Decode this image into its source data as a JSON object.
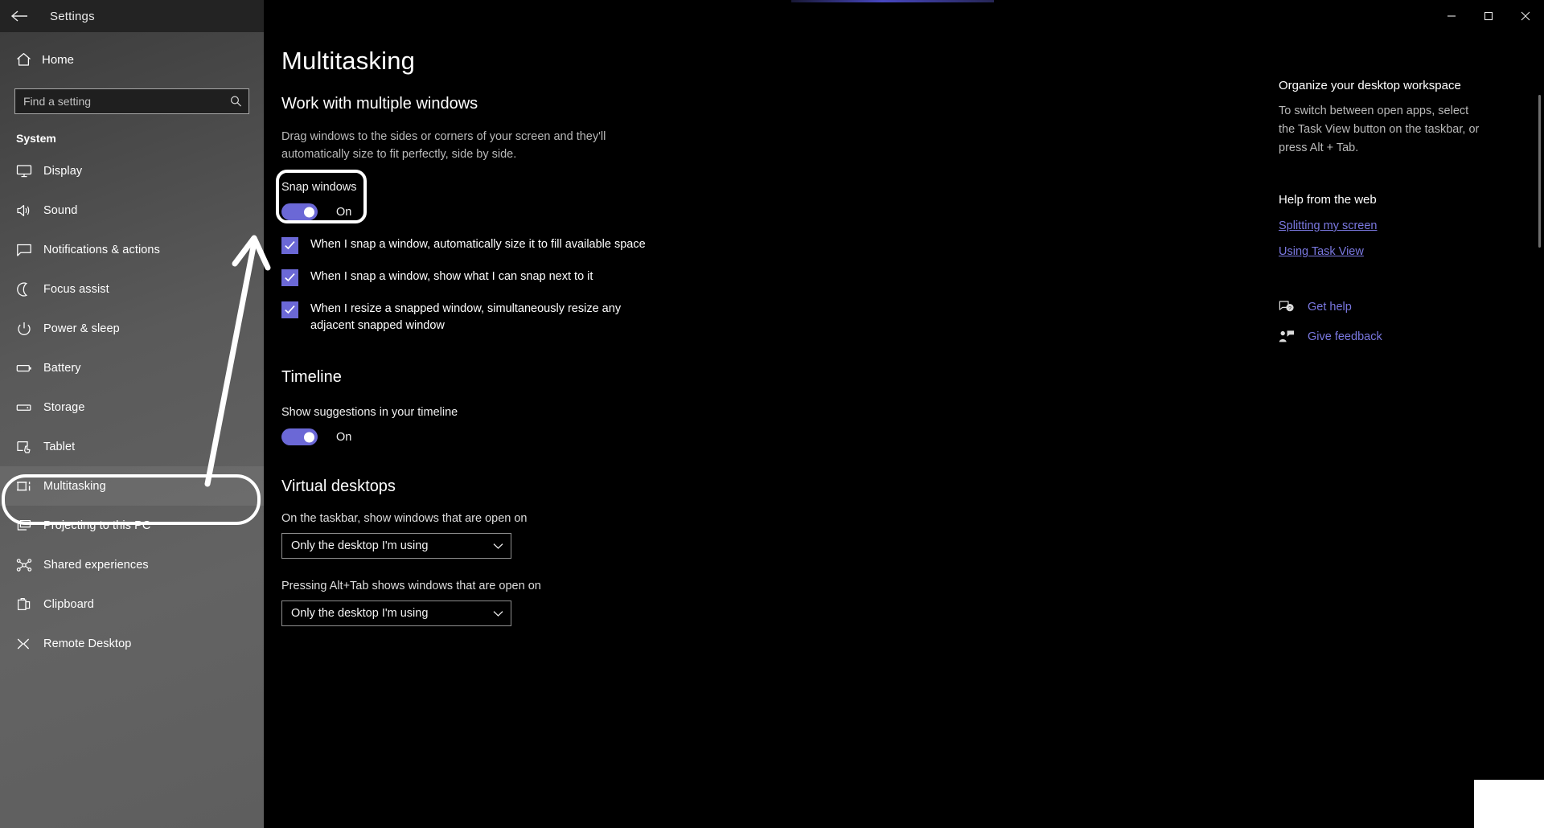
{
  "window": {
    "app_title": "Settings",
    "back_icon": "back-arrow-icon",
    "minimize_label": "–",
    "maximize_label": "❐",
    "close_label": "✕"
  },
  "sidebar": {
    "home_label": "Home",
    "home_icon": "home-icon",
    "search": {
      "placeholder": "Find a setting",
      "value": "",
      "icon": "search-icon"
    },
    "group_title": "System",
    "items": [
      {
        "label": "Display",
        "icon": "monitor-icon",
        "selected": false
      },
      {
        "label": "Sound",
        "icon": "speaker-icon",
        "selected": false
      },
      {
        "label": "Notifications & actions",
        "icon": "chat-bubble-icon",
        "selected": false
      },
      {
        "label": "Focus assist",
        "icon": "moon-icon",
        "selected": false
      },
      {
        "label": "Power & sleep",
        "icon": "power-icon",
        "selected": false
      },
      {
        "label": "Battery",
        "icon": "battery-icon",
        "selected": false
      },
      {
        "label": "Storage",
        "icon": "drive-icon",
        "selected": false
      },
      {
        "label": "Tablet",
        "icon": "tablet-icon",
        "selected": false
      },
      {
        "label": "Multitasking",
        "icon": "multitasking-icon",
        "selected": true
      },
      {
        "label": "Projecting to this PC",
        "icon": "project-screen-icon",
        "selected": false
      },
      {
        "label": "Shared experiences",
        "icon": "share-nodes-icon",
        "selected": false
      },
      {
        "label": "Clipboard",
        "icon": "clipboard-icon",
        "selected": false
      },
      {
        "label": "Remote Desktop",
        "icon": "remote-desktop-icon",
        "selected": false
      }
    ]
  },
  "main": {
    "page_title": "Multitasking",
    "snap_section": {
      "heading": "Work with multiple windows",
      "description": "Drag windows to the sides or corners of your screen and they'll automatically size to fit perfectly, side by side.",
      "toggle_label": "Snap windows",
      "toggle_state": "On",
      "checkboxes": [
        {
          "label": "When I snap a window, automatically size it to fill available space",
          "checked": true
        },
        {
          "label": "When I snap a window, show what I can snap next to it",
          "checked": true
        },
        {
          "label": "When I resize a snapped window, simultaneously resize any adjacent snapped window",
          "checked": true
        }
      ]
    },
    "timeline_section": {
      "heading": "Timeline",
      "toggle_label": "Show suggestions in your timeline",
      "toggle_state": "On"
    },
    "virtual_desktops_section": {
      "heading": "Virtual desktops",
      "taskbar_label": "On the taskbar, show windows that are open on",
      "taskbar_value": "Only the desktop I'm using",
      "alttab_label": "Pressing Alt+Tab shows windows that are open on",
      "alttab_value": "Only the desktop I'm using"
    }
  },
  "right_panel": {
    "heading": "Organize your desktop workspace",
    "body": "To switch between open apps, select the Task View button on the taskbar, or press Alt + Tab.",
    "help_heading": "Help from the web",
    "links": [
      "Splitting my screen",
      "Using Task View"
    ],
    "actions": [
      {
        "label": "Get help",
        "icon": "get-help-icon"
      },
      {
        "label": "Give feedback",
        "icon": "give-feedback-icon"
      }
    ]
  },
  "annotations": {
    "highlight_color": "#ffffff",
    "sidebar_highlight_target": "Multitasking",
    "snap_highlight_target": "Snap windows",
    "arrow": "arrow-pointing-from-multitasking-to-snap-windows"
  },
  "theme": {
    "accent": "#6b68d6",
    "link": "#7a78e0",
    "background": "#000000",
    "sidebar_background": "#5a5a5a"
  }
}
